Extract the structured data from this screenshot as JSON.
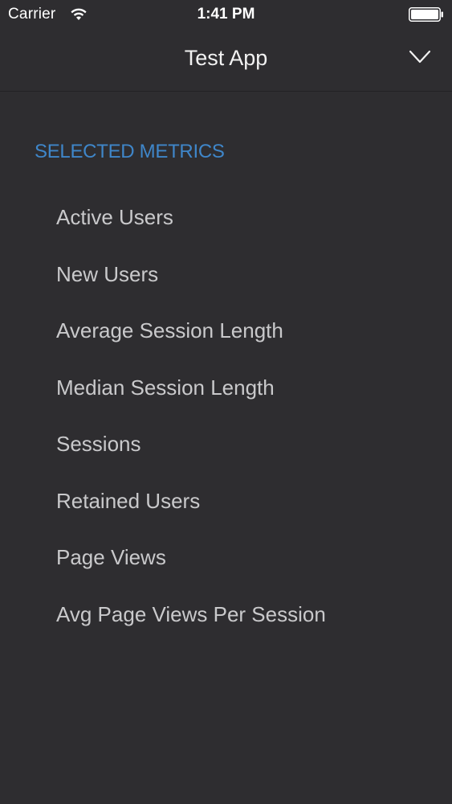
{
  "status_bar": {
    "carrier": "Carrier",
    "time": "1:41 PM",
    "wifi_icon": "wifi-icon",
    "battery_icon": "battery-icon"
  },
  "nav": {
    "title": "Test App",
    "toggle_icon": "chevron-down-icon"
  },
  "section": {
    "header": "SELECTED METRICS",
    "items": [
      {
        "label": "Active Users"
      },
      {
        "label": "New Users"
      },
      {
        "label": "Average Session Length"
      },
      {
        "label": "Median Session Length"
      },
      {
        "label": "Sessions"
      },
      {
        "label": "Retained Users"
      },
      {
        "label": "Page Views"
      },
      {
        "label": "Avg Page Views Per Session"
      }
    ]
  },
  "colors": {
    "background": "#2e2d30",
    "accent": "#3f86c9",
    "item_text": "#c9c9cb"
  }
}
